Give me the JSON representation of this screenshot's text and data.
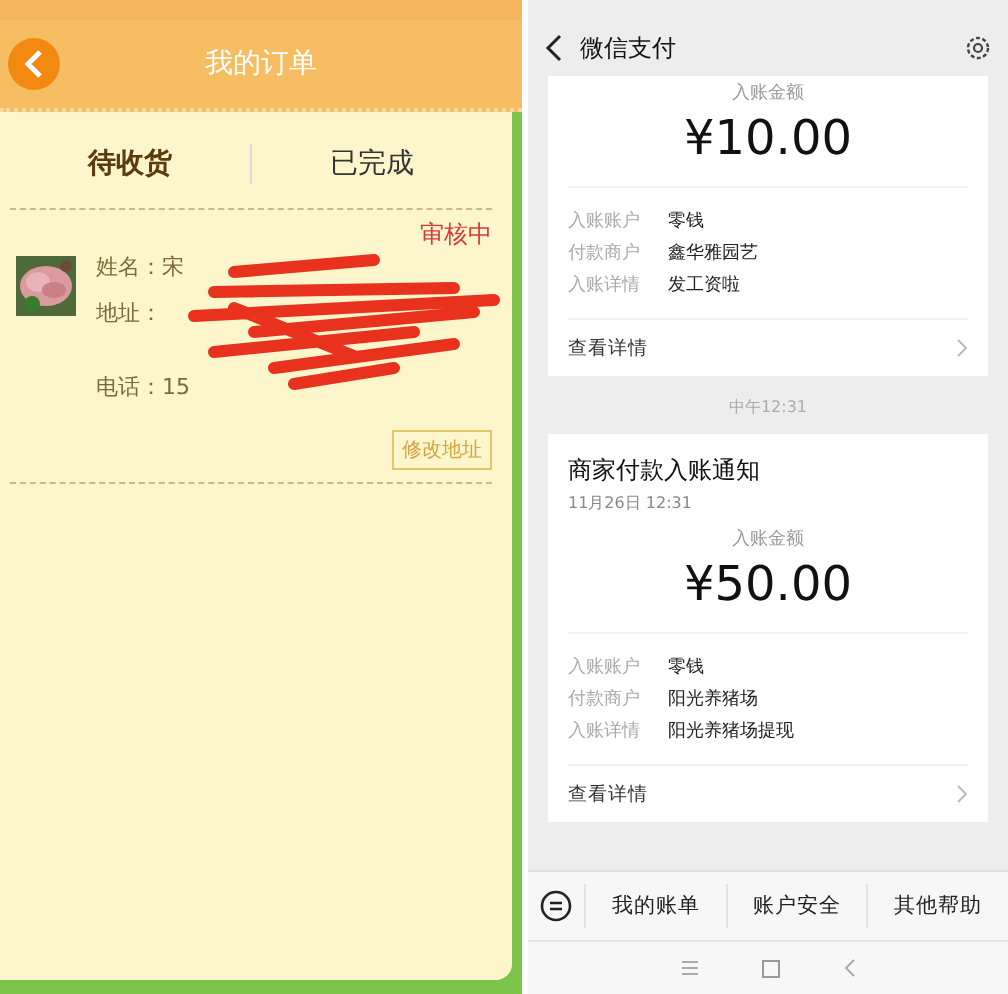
{
  "order_screen": {
    "title": "我的订单",
    "tabs": [
      {
        "label": "待收货",
        "selected": true
      },
      {
        "label": "已完成",
        "selected": false
      }
    ],
    "order": {
      "status": "审核中",
      "name": "姓名：宋",
      "address": "地址：",
      "phone": "电话：15",
      "edit_button": "修改地址"
    }
  },
  "wechat_screen": {
    "title": "微信支付",
    "payments": [
      {
        "amount_label": "入账金额",
        "amount": "¥10.00",
        "rows": [
          {
            "label": "入账账户",
            "value": "零钱"
          },
          {
            "label": "付款商户",
            "value": "鑫华雅园艺"
          },
          {
            "label": "入账详情",
            "value": "发工资啦"
          }
        ],
        "link": "查看详情"
      },
      {
        "time": "中午12:31",
        "heading": "商家付款入账通知",
        "date": "11月26日 12:31",
        "amount_label": "入账金额",
        "amount": "¥50.00",
        "rows": [
          {
            "label": "入账账户",
            "value": "零钱"
          },
          {
            "label": "付款商户",
            "value": "阳光养猪场"
          },
          {
            "label": "入账详情",
            "value": "阳光养猪场提现"
          }
        ],
        "link": "查看详情"
      }
    ],
    "menu": [
      "我的账单",
      "账户安全",
      "其他帮助"
    ]
  }
}
